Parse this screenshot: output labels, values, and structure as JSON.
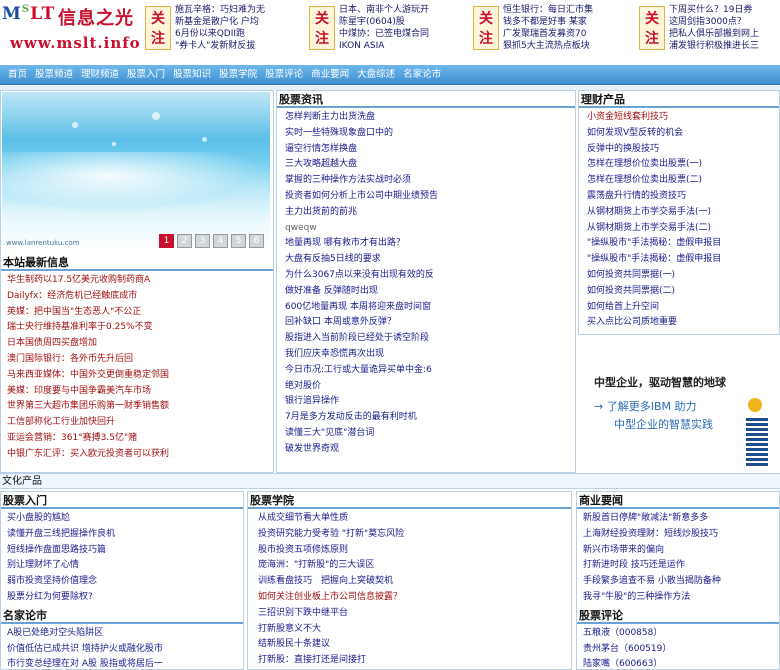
{
  "logo": {
    "brand_pre": "M",
    "brand_small": "S",
    "brand_post": "LT",
    "cn": "信息之光",
    "url": "www.mslt.info"
  },
  "focus": [
    {
      "tag": "关注",
      "items": [
        "施瓦辛格：巧妇难为无",
        "新基金是散户化 户均",
        "6月份以来QDII跑",
        "\"券卡人\"发新财反拔"
      ]
    },
    {
      "tag": "关注",
      "items": [
        "日本、南非个人游玩开",
        "陈星宇(0604)股",
        "中煤协：已签电煤合同",
        "IKON ASIA"
      ]
    },
    {
      "tag": "关注",
      "items": [
        "恒生银行：每日汇市集",
        "钱多不都是好事 某家",
        "广发聚瑞首发募资70",
        "狠抓5大主流热点板块"
      ]
    },
    {
      "tag": "关注",
      "items": [
        "下周买什么？19日券",
        "这周剑指3000点？",
        "把私人俱乐部搬到网上",
        "浦发银行积极推进长三"
      ]
    }
  ],
  "nav": [
    "首页",
    "股票频道",
    "理财频道",
    "股票入门",
    "股票知识",
    "股票学院",
    "股票评论",
    "商业要闻",
    "大盘综述",
    "名家论市"
  ],
  "slide": {
    "watermark": "www.lanrentuku.com",
    "pages": [
      "1",
      "2",
      "3",
      "4",
      "5",
      "6"
    ],
    "active": 0
  },
  "latest": {
    "title": "本站最新信息",
    "items": [
      "华生制药以17.5亿美元收购制药商A",
      "Dailyfx：经济危机已经触底成市",
      "英媒：把中国当\"生态恶人\"不公正",
      "瑞士央行维持基准利率于0.25%不变",
      "日本国债周四买盘增加",
      "澳门国际银行：各外币先升后回",
      "马来西亚媒体：中国外交更倒重稳定邻国",
      "美媒：印度要与中国争霸美汽车市场",
      "世界第三大超市集团乐购第一财季销售额",
      "工信部称化工行业加快回升",
      "亚运会营销：361°赛搏3.5亿\"赌",
      "中银广东汇评：买入欧元投资者可以获利"
    ]
  },
  "stock_news": {
    "title": "股票资讯",
    "items": [
      "怎样判断主力出货洗盘",
      "实时一些特殊现象盘口中的",
      "逼空行情怎样换盘",
      "三大攻略超越大盘",
      "掌握的三种操作方法实战时必须",
      "投资者如何分析上市公司中期业绩预告",
      "主力出货前的前兆",
      "qweqw",
      "地量再现 哪有救市才有出路？",
      "大盘有反抽5日线的要求",
      "为什么3067点以来没有出现有效的反",
      "做好准备 反弹随时出现",
      "600亿地量再现 本周将迎来盘时间窗",
      "回补缺口 本周或意外反弹？",
      "股指进入当前阶段已经处于诱空阶段",
      "我们应庆幸恐慌再次出现",
      "今日市况:工行或大量诡异买单中金:6",
      "绝对股价",
      "银行追异操作",
      "7月是多方发动反击的最有利时机",
      "读懂三大\"见底\"潜台词",
      "破发世界奇观"
    ]
  },
  "finance": {
    "title": "理财产品",
    "items": [
      "小资金短线套利技巧",
      "如何发现V型反转的机会",
      "反弹中的换股技巧",
      "怎样在理想价位卖出股票(一)",
      "怎样在理想价位卖出股票(二)",
      "震荡盘升行情的投资技巧",
      "从钢材期货上市学交易手法(一)",
      "从钢材期货上市学交易手法(二)",
      "\"操纵股市\"手法揭秘：虚假申报目",
      "\"操纵股市\"手法揭秘：虚假申报目",
      "如何投资共同票据(一)",
      "如何投资共同票据(二)",
      "如何给首上升空间",
      "买入点比公司质地重要"
    ]
  },
  "ad": {
    "line1": "中型企业，驱动智慧的地球",
    "line2": "→ 了解更多IBM 助力",
    "line3": "中型企业的智慧实践"
  },
  "catbar": "文化产品",
  "rumen": {
    "title": "股票入门",
    "items": [
      "买小盘股的尴尬",
      "读懂开盘三线把握操作良机",
      "短线操作盘面思路技巧篇",
      "别让理财坏了心情",
      "弱市投资坚持价值理念",
      "股票分红为何要除权?"
    ]
  },
  "xueyuan": {
    "title": "股票学院",
    "items": [
      "从成交细节看大单性质",
      "投资研究能力受考验 \"打新\"莫忘风险",
      "股市投资五项修炼原则",
      "庞海洲：\"打新股\"的三大误区",
      "训练看盘技巧　把握向上突破契机",
      "如何关注创业板上市公司信息披露？",
      "三招识别下跌中继平台",
      "打新股意义不大",
      "结新股民十条建议",
      "打新股：直接打还是间接打"
    ]
  },
  "yaowen": {
    "title": "商业要闻",
    "items": [
      "新股首日停牌\"敞减法\"新意多多",
      "上海财经投资理财：短线炒股技巧",
      "新兴市场带来的偏向",
      "打新进时段 技巧还是运作",
      "手段繁多追查不易 小散当揭防备种",
      "我寻\"牛股\"的三种操作方法"
    ]
  },
  "mingjia": {
    "title": "名家论市",
    "items": [
      "A股已处绝对空头陷阱区",
      "价值低估已成共识 增持护火或融化股市",
      "市行变总经理在对 A股 股指或将居后一"
    ]
  },
  "pinglun": {
    "title": "股票评论",
    "items": [
      "五粮液（000858）",
      "贵州茅台（600519）",
      "陆家嘴（600663）"
    ]
  },
  "colors": {
    "nav_top": "#6fb7ea",
    "nav_bottom": "#3d8fd0",
    "brand_red": "#c8102e",
    "link": "#1a1a8c",
    "border": "#b9cfe4"
  }
}
